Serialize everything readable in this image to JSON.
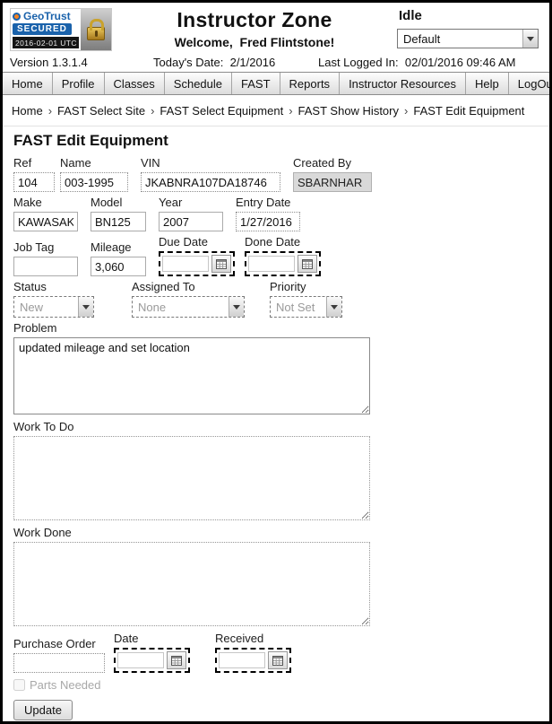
{
  "colors": {
    "brand_blue": "#1a62ab",
    "readonly_bg": "#d9d9d9",
    "disabled_text": "#9a9a9a",
    "nav_border": "#8c8c8c"
  },
  "icons": {
    "calendar": "calendar-grid",
    "dropdown_arrow": "▾",
    "padlock": "gold-padlock",
    "breadcrumb_separator": "›"
  },
  "header": {
    "badge": {
      "brand": "GeoTrust",
      "secured": "SECURED",
      "timestamp": "2016-02-01 UTC"
    },
    "title": "Instructor Zone",
    "welcome": "Welcome,  Fred Flintstone!",
    "status": "Idle",
    "status_select_value": "Default"
  },
  "infobar": {
    "version": "Version 1.3.1.4",
    "today_label": "Today's Date:",
    "today_value": "2/1/2016",
    "last_login_label": "Last Logged In:",
    "last_login_value": "02/01/2016 09:46 AM"
  },
  "nav": {
    "items": [
      "Home",
      "Profile",
      "Classes",
      "Schedule",
      "FAST",
      "Reports",
      "Instructor Resources",
      "Help",
      "LogOut"
    ]
  },
  "breadcrumb": {
    "separator": "›",
    "items": [
      "Home",
      "FAST Select Site",
      "FAST Select Equipment",
      "FAST Show History",
      "FAST Edit Equipment"
    ]
  },
  "page": {
    "title": "FAST Edit Equipment"
  },
  "form": {
    "ref": {
      "label": "Ref",
      "value": "104"
    },
    "name": {
      "label": "Name",
      "value": "003-1995"
    },
    "vin": {
      "label": "VIN",
      "value": "JKABNRA107DA18746"
    },
    "created_by": {
      "label": "Created By",
      "value": "SBARNHAR"
    },
    "make": {
      "label": "Make",
      "value": "KAWASAKI"
    },
    "model": {
      "label": "Model",
      "value": "BN125"
    },
    "year": {
      "label": "Year",
      "value": "2007"
    },
    "entry_date": {
      "label": "Entry Date",
      "value": "1/27/2016"
    },
    "job_tag": {
      "label": "Job Tag",
      "value": ""
    },
    "mileage": {
      "label": "Mileage",
      "value": "3,060"
    },
    "due_date": {
      "label": "Due Date",
      "value": ""
    },
    "done_date": {
      "label": "Done Date",
      "value": ""
    },
    "status": {
      "label": "Status",
      "value": "New"
    },
    "assigned_to": {
      "label": "Assigned To",
      "value": "None"
    },
    "priority": {
      "label": "Priority",
      "value": "Not Set"
    },
    "problem": {
      "label": "Problem",
      "value": "updated mileage and set location"
    },
    "work_to_do": {
      "label": "Work To Do",
      "value": ""
    },
    "work_done": {
      "label": "Work Done",
      "value": ""
    },
    "purchase_order": {
      "label": "Purchase Order",
      "value": ""
    },
    "po_date": {
      "label": "Date",
      "value": ""
    },
    "received": {
      "label": "Received",
      "value": ""
    },
    "parts_needed": {
      "label": "Parts Needed",
      "checked": false
    },
    "update_label": "Update"
  }
}
